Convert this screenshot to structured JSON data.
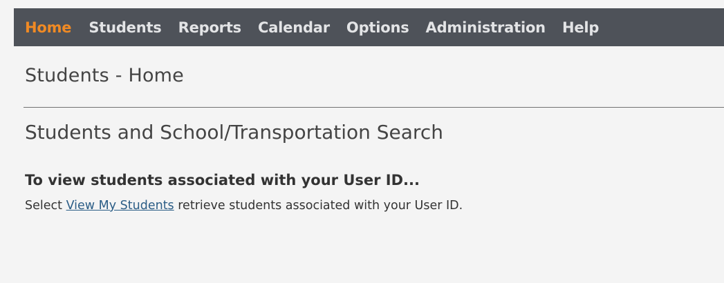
{
  "nav": {
    "items": [
      {
        "label": "Home",
        "active": true
      },
      {
        "label": "Students",
        "active": false
      },
      {
        "label": "Reports",
        "active": false
      },
      {
        "label": "Calendar",
        "active": false
      },
      {
        "label": "Options",
        "active": false
      },
      {
        "label": "Administration",
        "active": false
      },
      {
        "label": "Help",
        "active": false
      }
    ]
  },
  "page": {
    "title": "Students - Home",
    "section_title": "Students and School/Transportation Search",
    "hint_heading": "To view students associated with your User ID...",
    "hint_prefix": "Select ",
    "hint_link": "View My Students",
    "hint_suffix": " retrieve students associated with your User ID."
  },
  "colors": {
    "navbar_bg": "#4e5259",
    "nav_text": "#e3e4e6",
    "nav_active": "#f08a24",
    "link": "#2b5d86",
    "page_bg": "#f4f4f4"
  }
}
